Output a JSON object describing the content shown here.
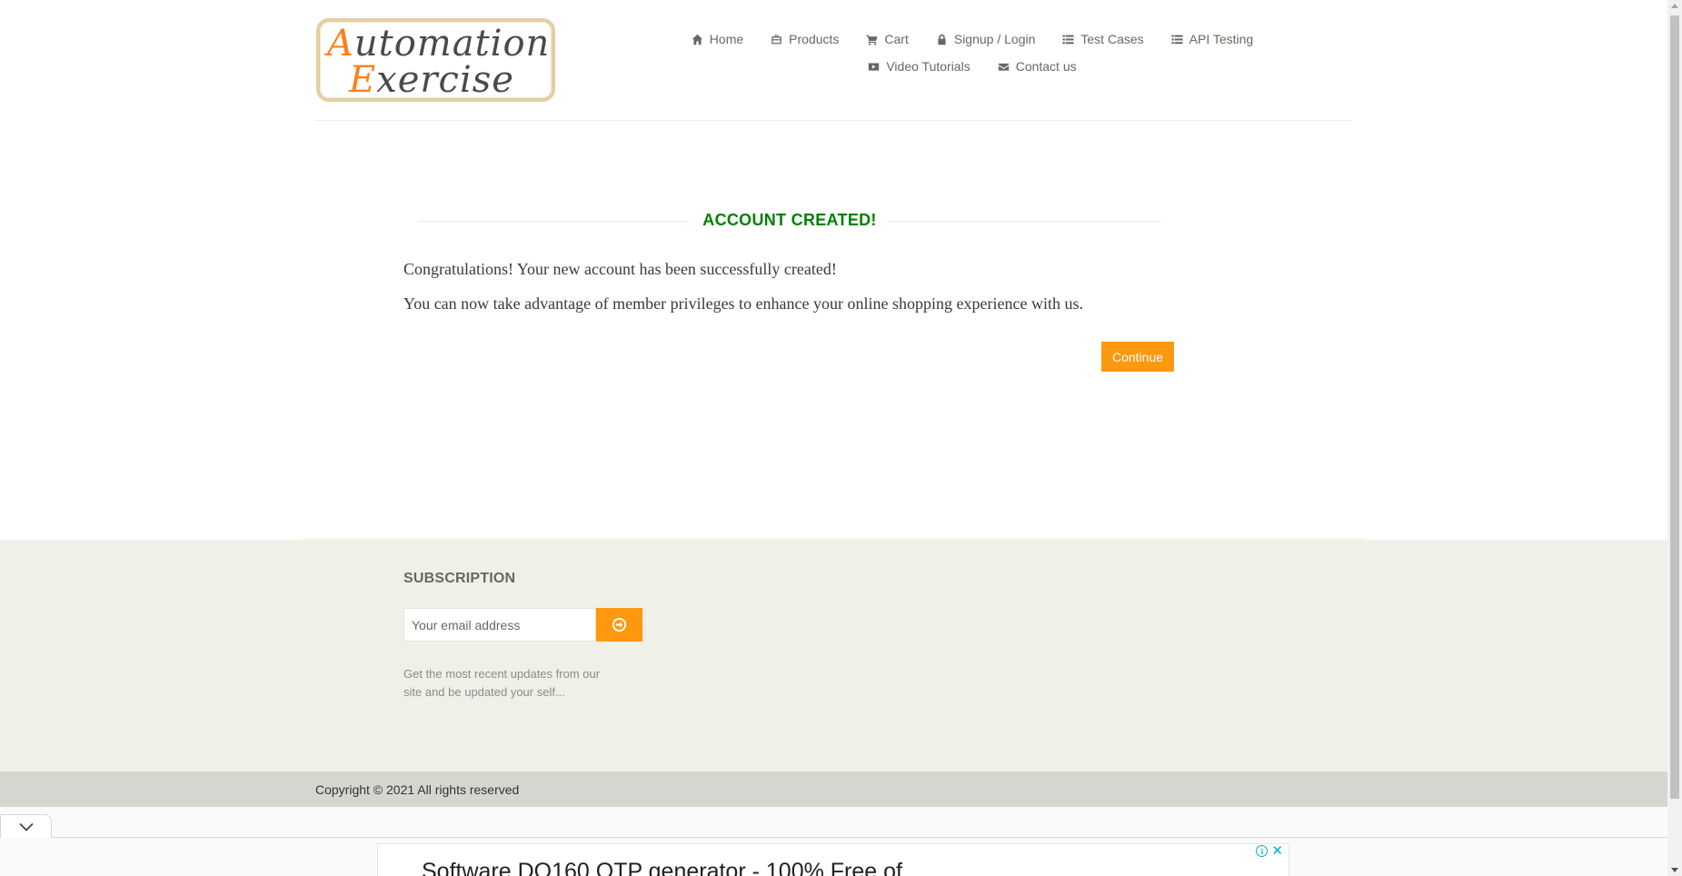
{
  "logo": {
    "line1_cap": "A",
    "line1_rest": "utomation",
    "line2_cap": "E",
    "line2_rest": "xercise"
  },
  "nav": {
    "row1": [
      {
        "icon": "home-icon",
        "label": "Home"
      },
      {
        "icon": "briefcase-icon",
        "label": "Products"
      },
      {
        "icon": "cart-icon",
        "label": "Cart"
      },
      {
        "icon": "lock-icon",
        "label": "Signup / Login"
      },
      {
        "icon": "list-icon",
        "label": "Test Cases"
      },
      {
        "icon": "list-icon",
        "label": "API Testing"
      }
    ],
    "row2": [
      {
        "icon": "video-icon",
        "label": "Video Tutorials"
      },
      {
        "icon": "envelope-icon",
        "label": "Contact us"
      }
    ]
  },
  "main": {
    "title": "ACCOUNT CREATED!",
    "message1": "Congratulations! Your new account has been successfully created!",
    "message2": "You can now take advantage of member privileges to enhance your online shopping experience with us.",
    "continue_label": "Continue"
  },
  "subscription": {
    "title": "SUBSCRIPTION",
    "placeholder": "Your email address",
    "desc": "Get the most recent updates from our site and be updated your self..."
  },
  "footer": {
    "copyright": "Copyright © 2021 All rights reserved"
  },
  "ad": {
    "text": "Software DO160 OTP generator - 100% Free of"
  },
  "colors": {
    "accent": "#fe980f",
    "title_green": "#008000",
    "footer_bg": "#f0f0e9",
    "copyright_bg": "#d6d6d0"
  }
}
